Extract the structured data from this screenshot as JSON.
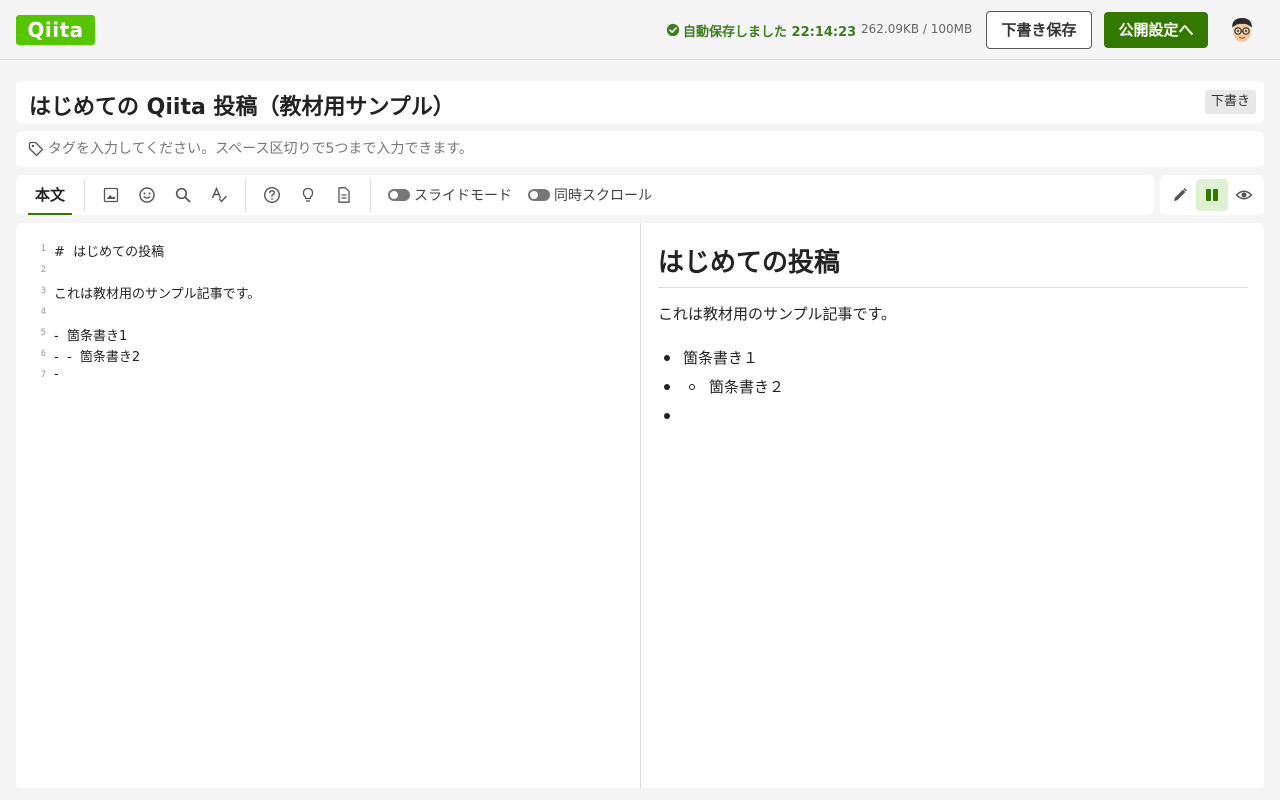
{
  "header": {
    "logo": "Qiita",
    "autosave": "自動保存しました 22:14:23",
    "storage": "262.09KB / 100MB",
    "save_draft": "下書き保存",
    "publish": "公開設定へ"
  },
  "article": {
    "title": "はじめての Qiita 投稿（教材用サンプル）",
    "status_badge": "下書き",
    "tags_placeholder": "タグを入力してください。スペース区切りで5つまで入力できます。"
  },
  "toolbar": {
    "tab_body": "本文",
    "slide_mode": "スライドモード",
    "sync_scroll": "同時スクロール"
  },
  "editor": {
    "lines": [
      {
        "n": "1",
        "text": "#  はじめての投稿"
      },
      {
        "n": "2",
        "text": ""
      },
      {
        "n": "3",
        "text": "これは教材用のサンプル記事です。"
      },
      {
        "n": "4",
        "text": ""
      },
      {
        "n": "5",
        "text": "-  箇条書き1"
      },
      {
        "n": "6",
        "text": "-  -  箇条書き2"
      },
      {
        "n": "7",
        "text": "-"
      }
    ]
  },
  "preview": {
    "heading": "はじめての投稿",
    "paragraph": "これは教材用のサンプル記事です。",
    "item1": "箇条書き１",
    "item2": "箇条書き２"
  },
  "colors": {
    "brand": "#55c500",
    "publish_button": "#337900",
    "autosave_text": "#3e7d1f"
  }
}
